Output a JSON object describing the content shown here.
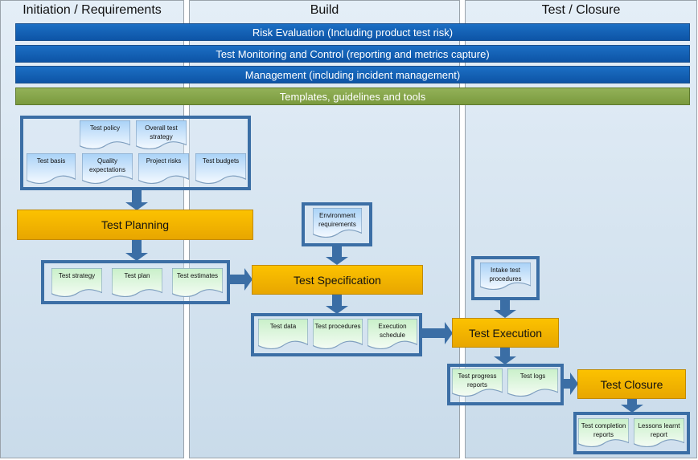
{
  "columns": [
    "Initiation / Requirements",
    "Build",
    "Test / Closure"
  ],
  "bars": [
    {
      "label": "Risk Evaluation (Including product test risk)",
      "color": "#1565b8"
    },
    {
      "label": "Test Monitoring and Control (reporting and metrics capture)",
      "color": "#1565b8"
    },
    {
      "label": "Management (including incident management)",
      "color": "#1565b8"
    },
    {
      "label": "Templates, guidelines and tools",
      "color": "#86a64b"
    }
  ],
  "processes": [
    "Test Planning",
    "Test Specification",
    "Test Execution",
    "Test Closure"
  ],
  "documents": {
    "planning_inputs": [
      "Test policy",
      "Overall test strategy",
      "Test basis",
      "Quality expectations",
      "Project risks",
      "Test budgets"
    ],
    "planning_outputs": [
      "Test strategy",
      "Test plan",
      "Test estimates"
    ],
    "specification_inputs": [
      "Environment requirements"
    ],
    "specification_outputs": [
      "Test data",
      "Test procedures",
      "Execution schedule"
    ],
    "execution_inputs": [
      "Intake test procedures"
    ],
    "execution_outputs": [
      "Test progress reports",
      "Test logs"
    ],
    "closure_outputs": [
      "Test completion reports",
      "Lessons learnt report"
    ]
  },
  "colors": {
    "process": "#f5b400",
    "arrow": "#3b6ea5",
    "input_doc": "#a9d2f7",
    "output_doc": "#c9f0c9"
  }
}
